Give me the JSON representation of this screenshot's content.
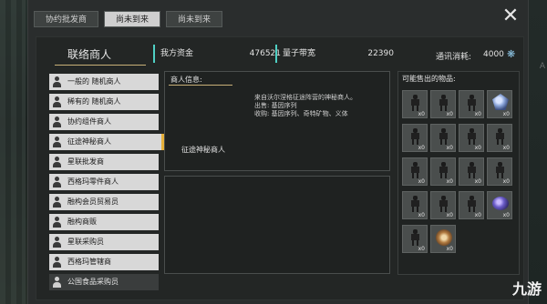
{
  "tabs": [
    "协约批发商",
    "尚未到来",
    "尚未到来"
  ],
  "active_tab": 1,
  "contact_title": "联络商人",
  "stats": {
    "funds_label": "我方资金",
    "funds_value": "476521",
    "bandwidth_label": "量子带宽",
    "bandwidth_value": "22390",
    "comm_label": "通讯消耗:",
    "comm_value": "4000"
  },
  "merchants": [
    "一般的 随机商人",
    "稀有的 随机商人",
    "协约组件商人",
    "征途神秘商人",
    "星联批发商",
    "西格玛零件商人",
    "融构会员贸易员",
    "融构商贩",
    "星联采购员",
    "西格玛管辖商",
    "公国食品采购员"
  ],
  "selected_merchant": 3,
  "info": {
    "title": "商人信息:",
    "desc_line1": "来自沃尔涅格征途阵营的神秘商人。",
    "desc_line2": "出售: 基因序列",
    "desc_line3": "收购: 基因序列、奇特矿物、义体",
    "name": "征途神秘商人"
  },
  "goods_title": "可能售出的物品:",
  "goods": [
    {
      "icon": "armor-icon",
      "qty": "x0"
    },
    {
      "icon": "armor-icon",
      "qty": "x0"
    },
    {
      "icon": "armor-icon",
      "qty": "x0"
    },
    {
      "icon": "crystal-icon",
      "qty": "x0"
    },
    {
      "icon": "armor-icon",
      "qty": "x0"
    },
    {
      "icon": "armor-icon",
      "qty": "x0"
    },
    {
      "icon": "armor-icon",
      "qty": "x0"
    },
    {
      "icon": "armor-icon",
      "qty": "x0"
    },
    {
      "icon": "armor-icon",
      "qty": "x0"
    },
    {
      "icon": "armor-icon",
      "qty": "x0"
    },
    {
      "icon": "armor-icon",
      "qty": "x0"
    },
    {
      "icon": "armor-icon",
      "qty": "x0"
    },
    {
      "icon": "armor-icon",
      "qty": "x0"
    },
    {
      "icon": "armor-icon",
      "qty": "x0"
    },
    {
      "icon": "armor-icon",
      "qty": "x0"
    },
    {
      "icon": "ore-icon",
      "qty": "x0"
    },
    {
      "icon": "armor-icon",
      "qty": "x0"
    },
    {
      "icon": "artifact-icon",
      "qty": "x0"
    }
  ],
  "watermark": "九游",
  "colors": {
    "accent_gold": "#e6b13b",
    "stat_bar": "#4fd0c4"
  }
}
